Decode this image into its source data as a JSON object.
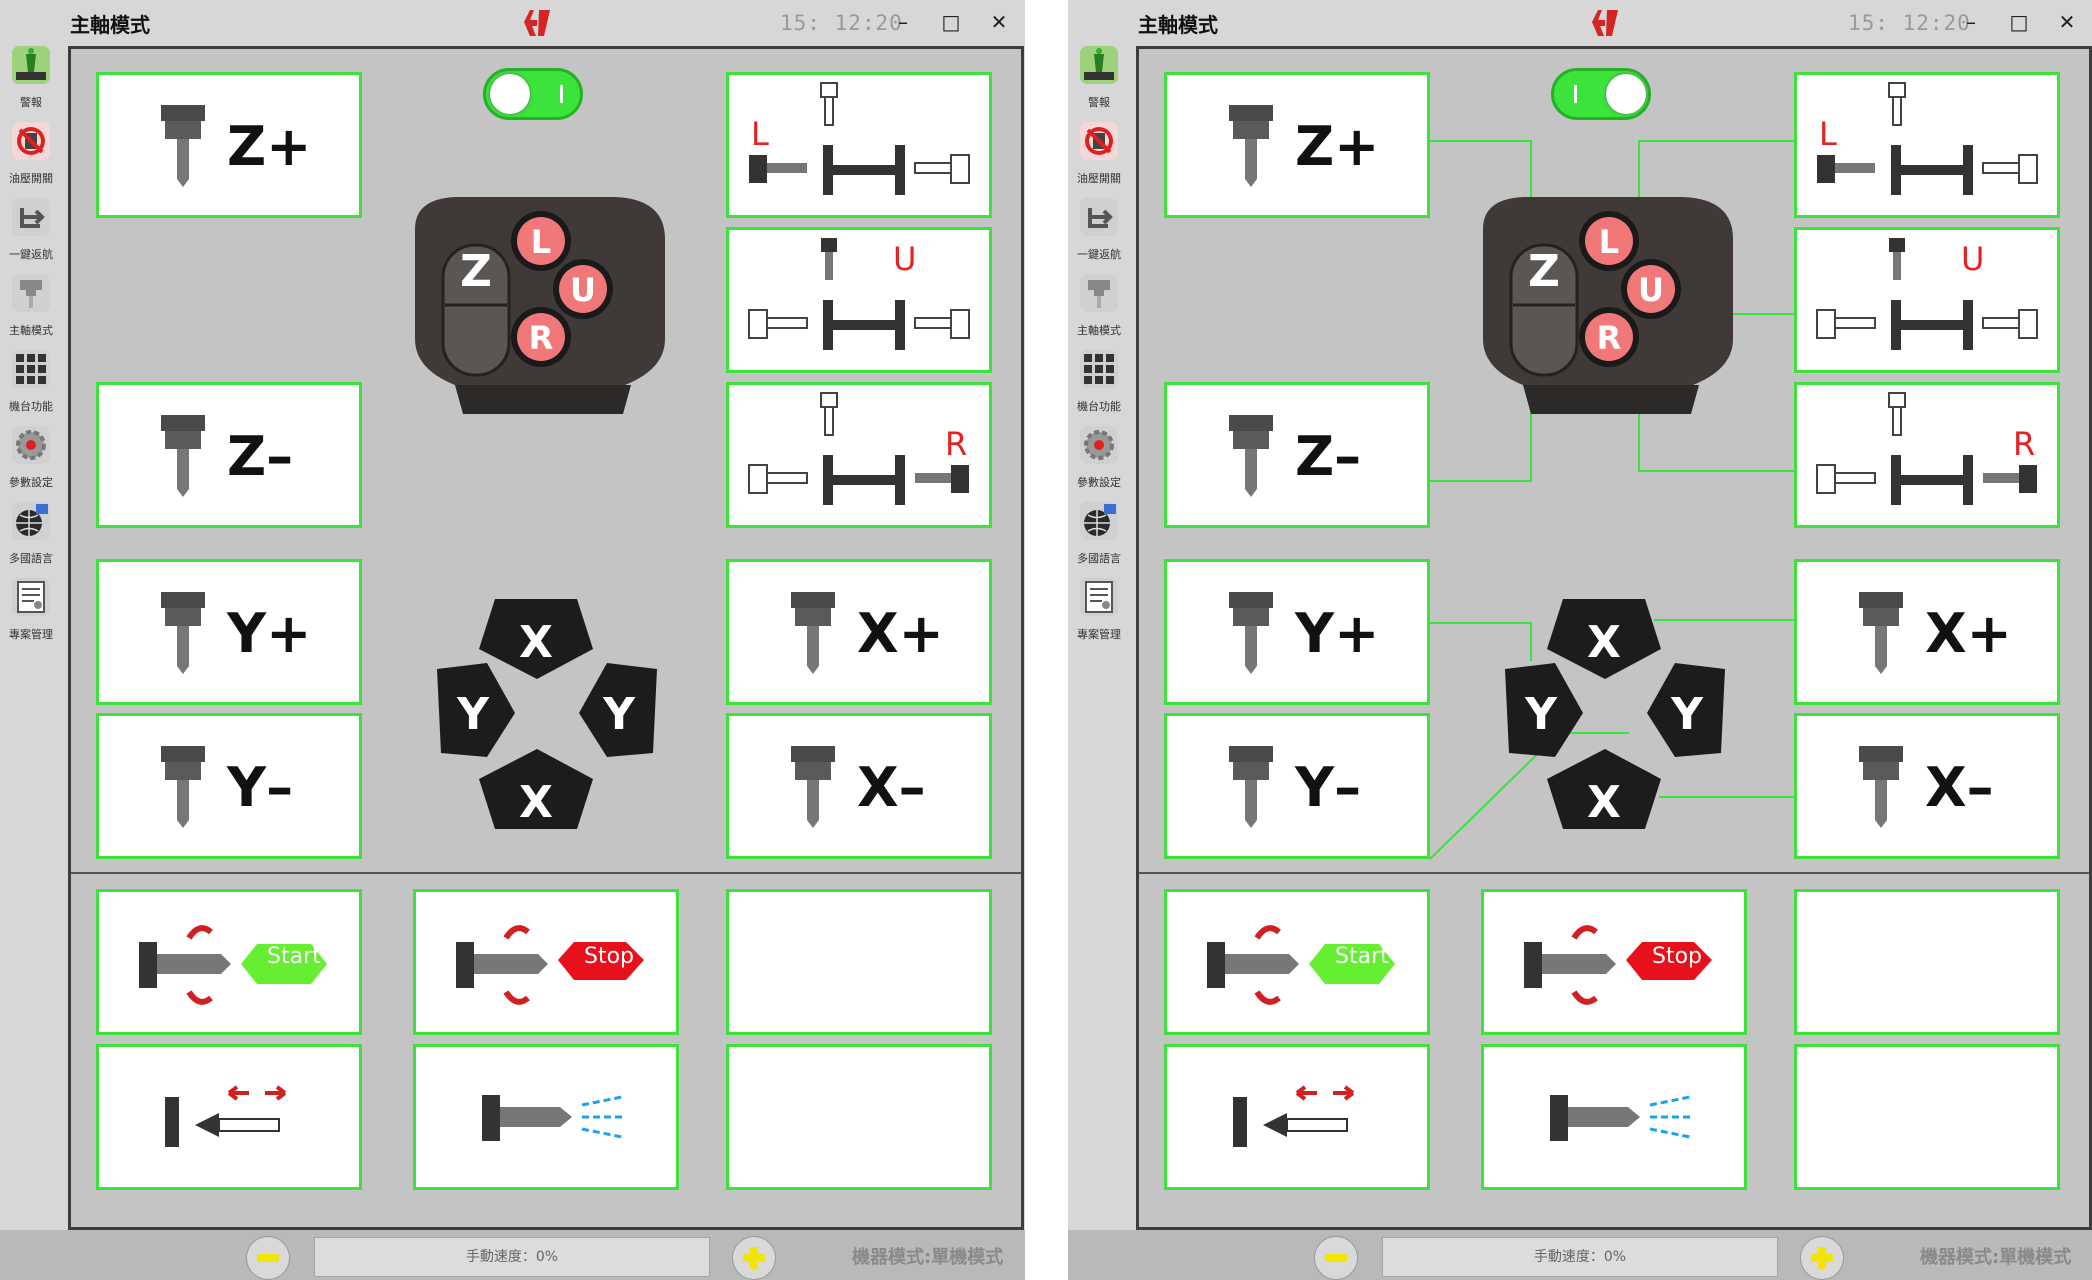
{
  "left": {
    "title": "主軸模式",
    "clock": "15: 12:20",
    "sidebar": [
      "警報",
      "油壓開關",
      "一鍵返航",
      "主軸模式",
      "機台功能",
      "參數設定",
      "多國語言",
      "專案管理"
    ],
    "toggle_state": "off",
    "tiles": {
      "z_plus": "Z+",
      "z_minus": "Z–",
      "y_plus": "Y+",
      "y_minus": "Y–",
      "x_plus": "X+",
      "x_minus": "X–",
      "spindle_l": "L",
      "spindle_u": "U",
      "spindle_r": "R",
      "rotate_start": "Start",
      "rotate_stop": "Stop"
    },
    "handwheel": {
      "z": "Z",
      "l": "L",
      "u": "U",
      "r": "R"
    },
    "dpad": {
      "up": "X",
      "left": "Y",
      "right": "Y",
      "down": "X"
    },
    "bottom": {
      "speed_text": "手動速度：0%",
      "mode_text": "機器模式:單機模式"
    }
  },
  "right": {
    "title": "主軸模式",
    "clock": "15: 12:20",
    "sidebar": [
      "警報",
      "油壓開關",
      "一鍵返航",
      "主軸模式",
      "機台功能",
      "參數設定",
      "多國語言",
      "專案管理"
    ],
    "toggle_state": "on",
    "tiles": {
      "z_plus": "Z+",
      "z_minus": "Z–",
      "y_plus": "Y+",
      "y_minus": "Y–",
      "x_plus": "X+",
      "x_minus": "X–",
      "spindle_l": "L",
      "spindle_u": "U",
      "spindle_r": "R",
      "rotate_start": "Start",
      "rotate_stop": "Stop"
    },
    "handwheel": {
      "z": "Z",
      "l": "L",
      "u": "U",
      "r": "R"
    },
    "dpad": {
      "up": "X",
      "left": "Y",
      "right": "Y",
      "down": "X"
    },
    "bottom": {
      "speed_text": "手動速度：0%",
      "mode_text": "機器模式:單機模式"
    }
  },
  "colors": {
    "tile_border": "#3be33b",
    "wire": "#3be33b",
    "red_button": "#f07878",
    "red_letter": "#e52222",
    "start_green": "#66ee33",
    "stop_red": "#e8101a",
    "plus_yellow": "#f2e600",
    "toggle_on": "#3be33b"
  },
  "icons": {
    "alarm": "alarm-icon",
    "hydraulic": "hydraulic-switch-icon",
    "return": "return-home-icon",
    "spindle": "spindle-mode-icon",
    "machine": "machine-function-icon",
    "settings": "gear-icon",
    "language": "globe-icon",
    "project": "document-icon"
  }
}
